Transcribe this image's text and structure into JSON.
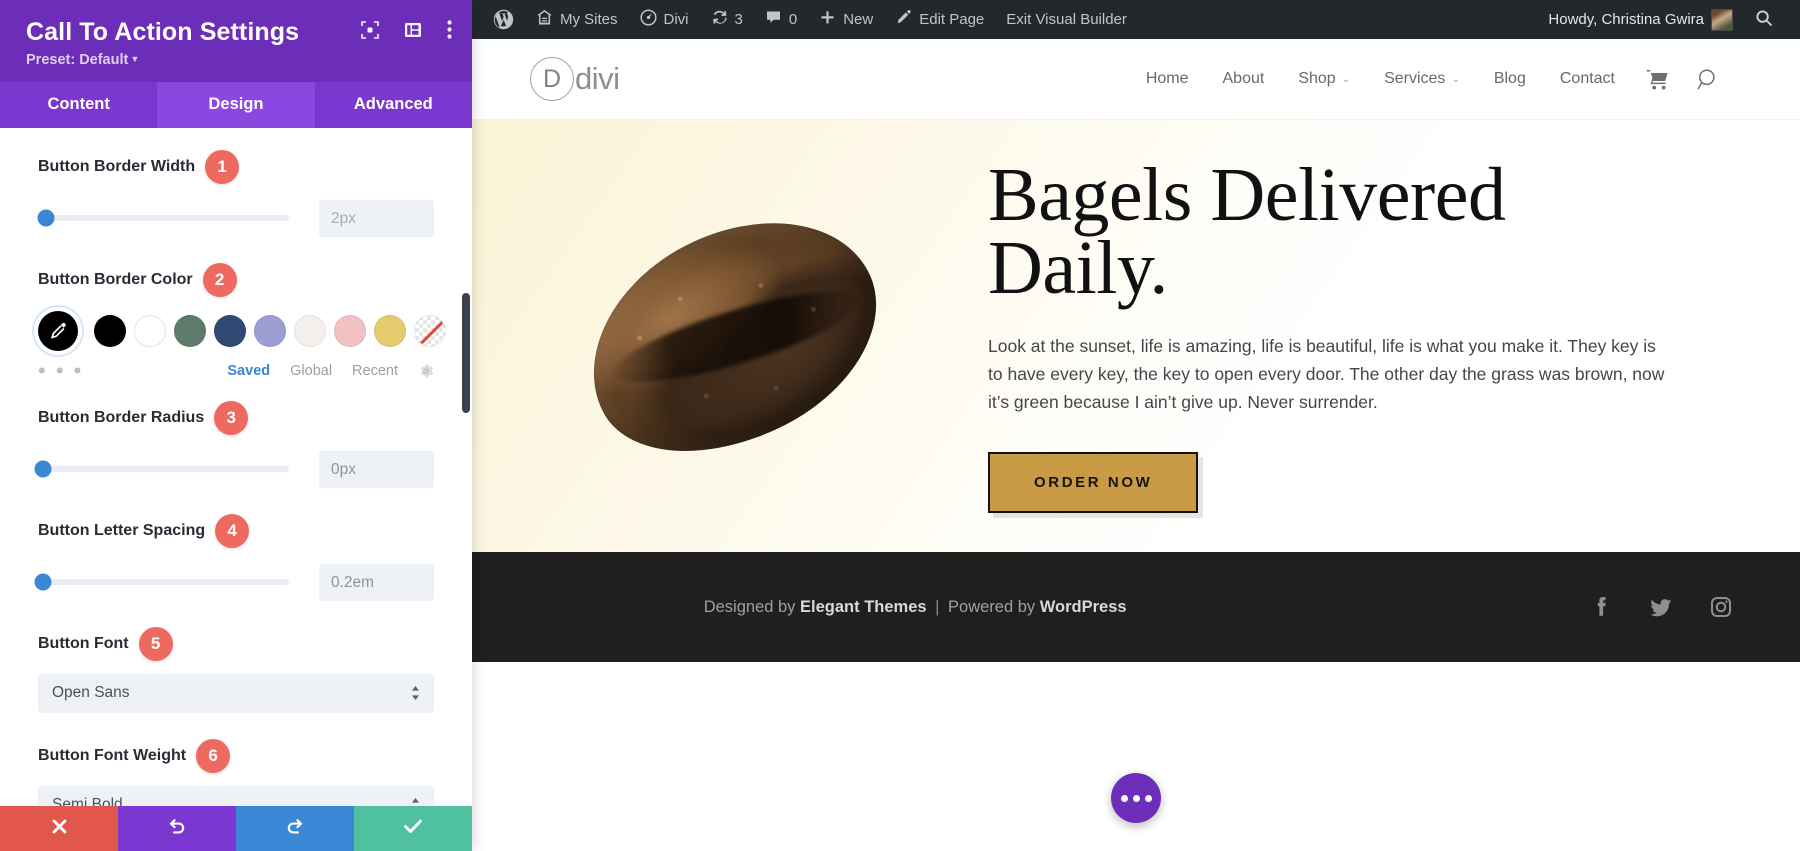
{
  "panel": {
    "title": "Call To Action Settings",
    "preset_label": "Preset: Default",
    "header_icons": [
      {
        "name": "responsive-preview-icon"
      },
      {
        "name": "panel-layout-icon"
      },
      {
        "name": "more-options-icon"
      }
    ],
    "tabs": [
      {
        "label": "Content",
        "active": false
      },
      {
        "label": "Design",
        "active": true
      },
      {
        "label": "Advanced",
        "active": false
      }
    ],
    "fields": [
      {
        "type": "slider",
        "label": "Button Border Width",
        "step": "1",
        "value": "2px",
        "is_placeholder": true,
        "knob_percent": 3
      },
      {
        "type": "color",
        "label": "Button Border Color",
        "step": "2",
        "swatches": [
          {
            "name": "swatch-black",
            "color": "#000000"
          },
          {
            "name": "swatch-white",
            "color": "#ffffff"
          },
          {
            "name": "swatch-sage-green",
            "color": "#5d7a6b"
          },
          {
            "name": "swatch-navy-blue",
            "color": "#2e4a72"
          },
          {
            "name": "swatch-periwinkle",
            "color": "#9a9ed2"
          },
          {
            "name": "swatch-off-white",
            "color": "#f2efec"
          },
          {
            "name": "swatch-blush-pink",
            "color": "#f0c2c3"
          },
          {
            "name": "swatch-gold",
            "color": "#e4cb6e"
          },
          {
            "name": "swatch-transparent",
            "color": "none"
          }
        ],
        "links": [
          {
            "label": "Saved",
            "active": true
          },
          {
            "label": "Global",
            "active": false
          },
          {
            "label": "Recent",
            "active": false
          }
        ],
        "dots_label": "• • •"
      },
      {
        "type": "slider",
        "label": "Button Border Radius",
        "step": "3",
        "value": "0px",
        "is_placeholder": false,
        "knob_percent": 2
      },
      {
        "type": "slider",
        "label": "Button Letter Spacing",
        "step": "4",
        "value": "0.2em",
        "is_placeholder": false,
        "knob_percent": 2
      },
      {
        "type": "select",
        "label": "Button Font",
        "step": "5",
        "value": "Open Sans"
      },
      {
        "type": "select",
        "label": "Button Font Weight",
        "step": "6",
        "value": "Semi Bold"
      }
    ],
    "actions": [
      {
        "name": "cancel-button",
        "icon": "close-icon",
        "color": "#e2574c"
      },
      {
        "name": "undo-button",
        "icon": "undo-icon",
        "color": "#7b37cf"
      },
      {
        "name": "redo-button",
        "icon": "redo-icon",
        "color": "#3b87d6"
      },
      {
        "name": "save-button",
        "icon": "check-icon",
        "color": "#4fc1a0"
      }
    ],
    "colors": {
      "header_bg": "#6c2eb9",
      "tabs_bg": "#7b37cf",
      "tab_active_bg": "#8c47e0",
      "badge": "#ee6a61",
      "slider_knob": "#3b87d6"
    }
  },
  "adminbar": {
    "items": [
      {
        "name": "wordpress-logo-icon",
        "label": ""
      },
      {
        "name": "my-sites-icon",
        "label": "My Sites"
      },
      {
        "name": "divi-icon",
        "label": "Divi"
      },
      {
        "name": "updates-icon",
        "label": "3"
      },
      {
        "name": "comments-icon",
        "label": "0"
      },
      {
        "name": "new-icon",
        "label": "New"
      },
      {
        "name": "edit-page-icon",
        "label": "Edit Page"
      },
      {
        "name": "exit-visual-builder",
        "label": "Exit Visual Builder"
      }
    ],
    "howdy": "Howdy, Christina Gwira",
    "search_icon": "search-icon"
  },
  "site": {
    "logo": {
      "mark": "D",
      "text": "divi"
    },
    "nav": [
      {
        "label": "Home",
        "has_submenu": false
      },
      {
        "label": "About",
        "has_submenu": false
      },
      {
        "label": "Shop",
        "has_submenu": true
      },
      {
        "label": "Services",
        "has_submenu": true
      },
      {
        "label": "Blog",
        "has_submenu": false
      },
      {
        "label": "Contact",
        "has_submenu": false
      }
    ],
    "nav_icons": [
      {
        "name": "cart-icon"
      },
      {
        "name": "search-icon"
      }
    ],
    "hero": {
      "image_alt": "bagel-loaf-image",
      "title": "Bagels Delivered Daily.",
      "body": "Look at the sunset, life is amazing, life is beautiful, life is what you make it. They key is to have every key, the key to open every door. The other day the grass was brown, now it’s green because I ain’t give up. Never surrender.",
      "button_label": "ORDER NOW",
      "button_bg": "#c89b44",
      "button_border": "#15120c"
    },
    "footer": {
      "credit_prefix": "Designed by ",
      "credit_brand": "Elegant Themes",
      "credit_sep": " | ",
      "credit_middle": "Powered by ",
      "credit_brand2": "WordPress",
      "social": [
        {
          "name": "facebook-icon"
        },
        {
          "name": "twitter-icon"
        },
        {
          "name": "instagram-icon"
        }
      ]
    },
    "fab": {
      "name": "divi-menu-fab",
      "color": "#6c2eb9"
    }
  }
}
